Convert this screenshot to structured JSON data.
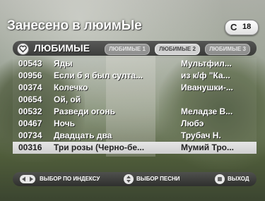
{
  "header": {
    "title": "Занесено в люимЫе",
    "count_letter": "C",
    "count": "18"
  },
  "tabs": {
    "main": "ЛЮБИМЫЕ",
    "items": [
      {
        "label": "ЛЮБИМЫЕ 1",
        "selected": false
      },
      {
        "label": "ЛЮБИМЫЕ 2",
        "selected": true
      },
      {
        "label": "ЛЮБИМЫЕ 3",
        "selected": false
      }
    ]
  },
  "songs": [
    {
      "num": "00543",
      "title": "Яды",
      "artist": "Мультфил..."
    },
    {
      "num": "00956",
      "title": "Если б я был султа...",
      "artist": "из к/ф \"Ка..."
    },
    {
      "num": "00374",
      "title": "Колечко",
      "artist": "Иванушки-..."
    },
    {
      "num": "00654",
      "title": "Ой, ой",
      "artist": ""
    },
    {
      "num": "00532",
      "title": "Разведи огонь",
      "artist": "Меладзе В..."
    },
    {
      "num": "00467",
      "title": "Ночь",
      "artist": "Любэ"
    },
    {
      "num": "00734",
      "title": "Двадцать два",
      "artist": "Трубач Н."
    },
    {
      "num": "00316",
      "title": "Три розы (Черно-бе...",
      "artist": "Мумий Тро..."
    }
  ],
  "selected_index": 7,
  "footer": {
    "by_index": "ВЫБОР ПО ИНДЕКСУ",
    "song_select": "ВЫБОР ПЕСНИ",
    "exit": "ВЫХОД"
  },
  "icons": {
    "heart": "heart-icon",
    "left_right": "left-right-arrows-icon",
    "up_down": "up-down-arrows-icon",
    "ok": "ok-square-icon"
  }
}
